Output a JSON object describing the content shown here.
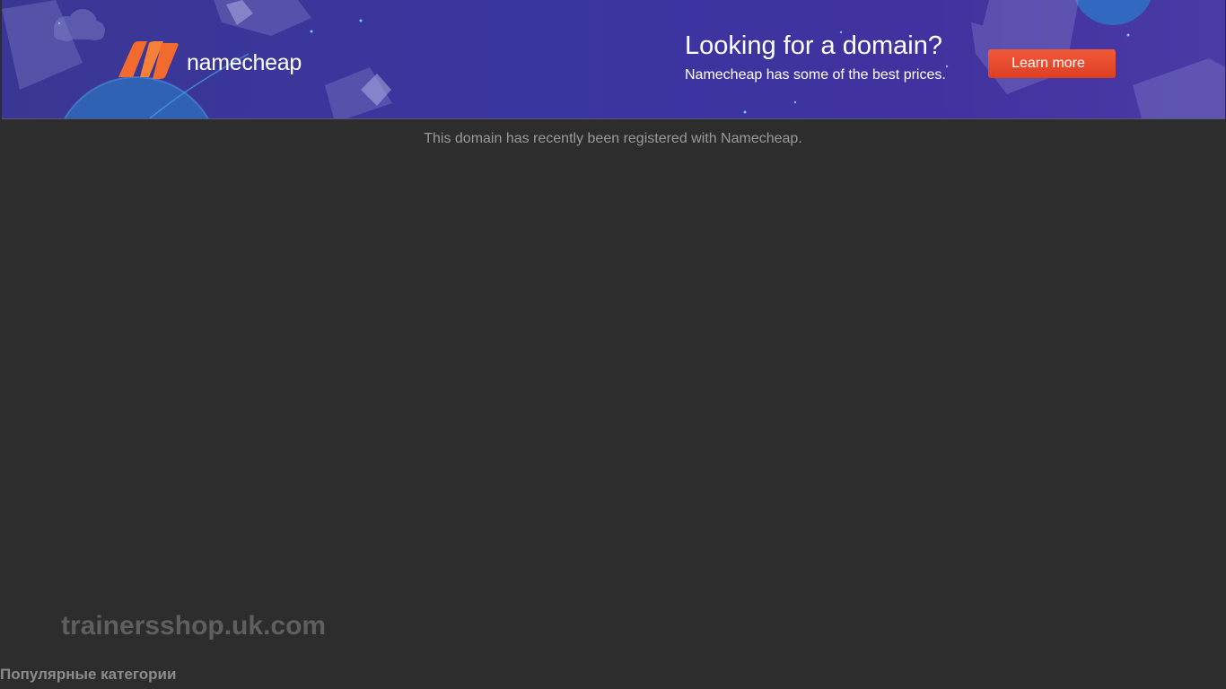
{
  "banner": {
    "brand": "namecheap",
    "logo_icon": "namecheap-n-logo",
    "promo_title": "Looking for a domain?",
    "promo_subtitle": "Namecheap has some of the best prices.",
    "button_label": "Learn more",
    "colors": {
      "background": "#3a369e",
      "accent": "#ef5b36",
      "logo_orange": "#f0703a"
    }
  },
  "notice": "This domain has recently been registered with Namecheap.",
  "domain": "trainersshop.uk.com",
  "categories_heading": "Популярные категории",
  "colors": {
    "page_background": "#2d2d2d"
  }
}
